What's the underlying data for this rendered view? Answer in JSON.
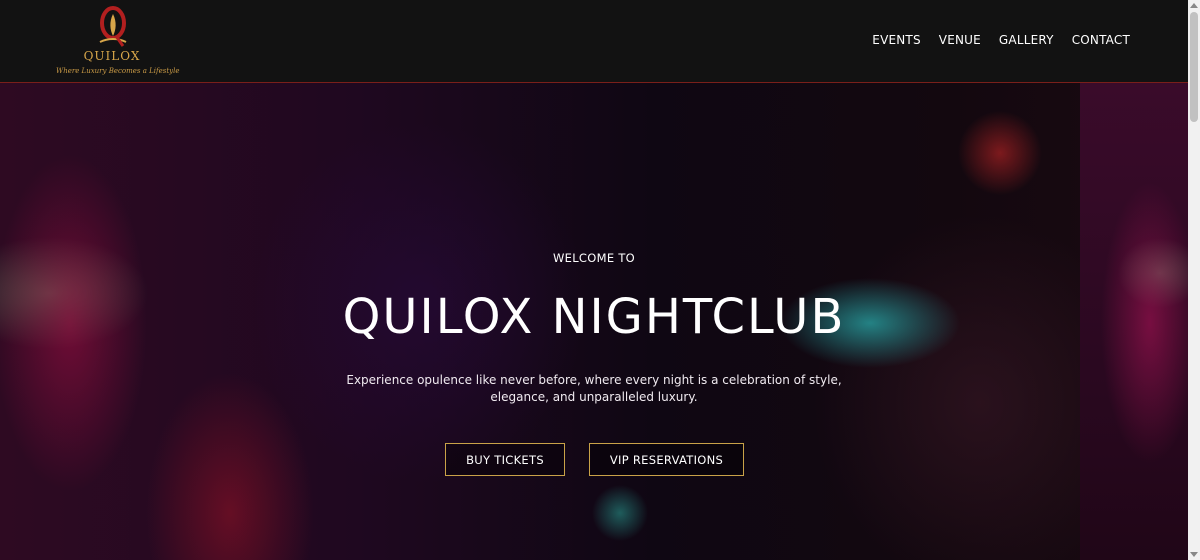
{
  "logo": {
    "name": "QUILOX",
    "tagline": "Where Luxury Becomes a Lifestyle",
    "icon": "q-flame-logo-icon",
    "colors": {
      "gold": "#d7a64a",
      "red": "#b21f1f"
    }
  },
  "nav": {
    "items": [
      {
        "label": "EVENTS"
      },
      {
        "label": "VENUE"
      },
      {
        "label": "GALLERY"
      },
      {
        "label": "CONTACT"
      }
    ]
  },
  "hero": {
    "welcome": "WELCOME TO",
    "title": "QUILOX NIGHTCLUB",
    "subtitle": "Experience opulence like never before, where every night is a celebration of style, elegance, and unparalleled luxury.",
    "buttons": {
      "tickets": "BUY TICKETS",
      "vip": "VIP RESERVATIONS"
    },
    "colors": {
      "button_border": "#c9a248",
      "header_border": "#7a1f1a"
    }
  }
}
